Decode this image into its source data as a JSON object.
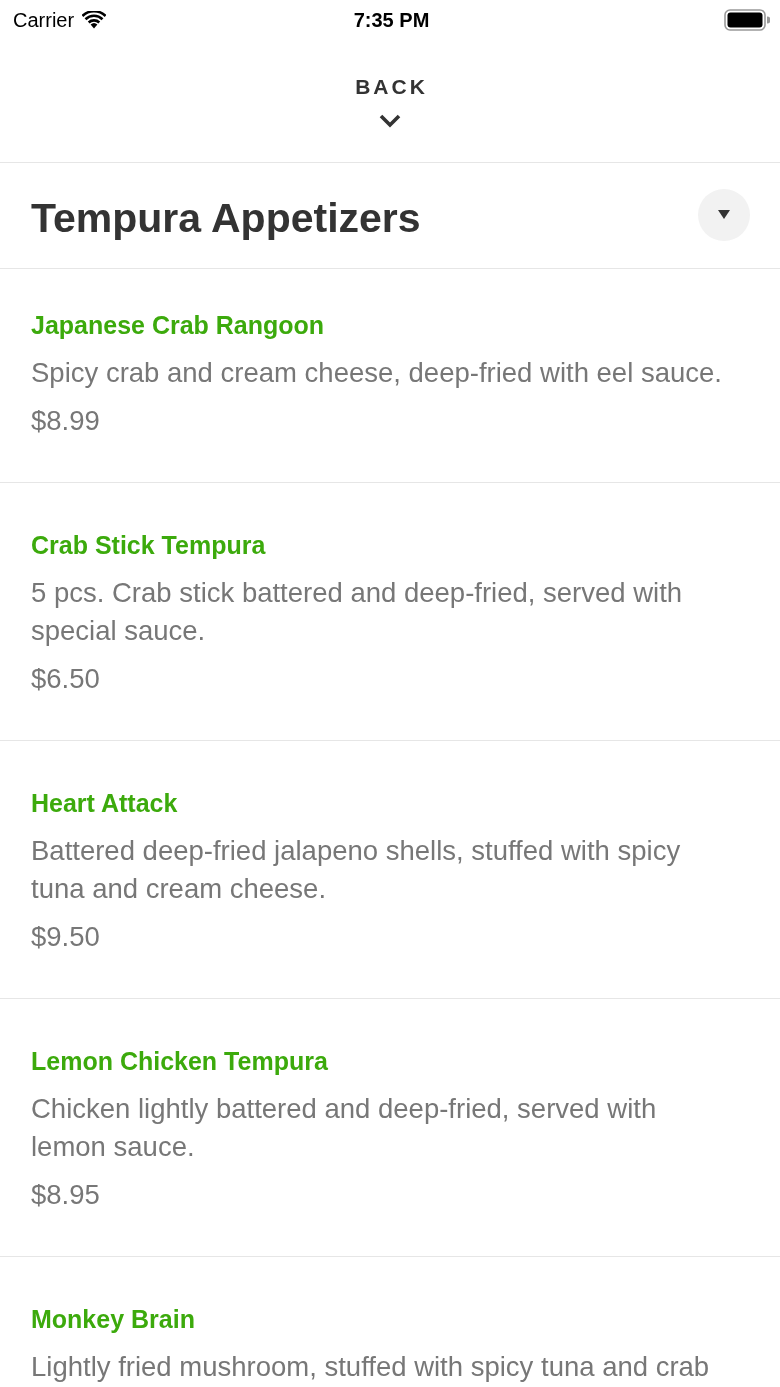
{
  "status_bar": {
    "carrier": "Carrier",
    "time": "7:35 PM"
  },
  "nav": {
    "back_label": "BACK"
  },
  "category": {
    "title": "Tempura Appetizers"
  },
  "items": [
    {
      "name": "Japanese Crab Rangoon",
      "description": "Spicy crab and cream cheese, deep-fried with eel sauce.",
      "price": "$8.99"
    },
    {
      "name": "Crab Stick Tempura",
      "description": "5 pcs. Crab stick battered and deep-fried, served with special sauce.",
      "price": "$6.50"
    },
    {
      "name": "Heart Attack",
      "description": "Battered deep-fried jalapeno shells, stuffed with spicy tuna and cream cheese.",
      "price": "$9.50"
    },
    {
      "name": "Lemon Chicken Tempura",
      "description": "Chicken lightly battered and deep-fried, served with lemon sauce.",
      "price": "$8.95"
    },
    {
      "name": "Monkey Brain",
      "description": "Lightly fried mushroom, stuffed with spicy tuna and crab"
    }
  ]
}
